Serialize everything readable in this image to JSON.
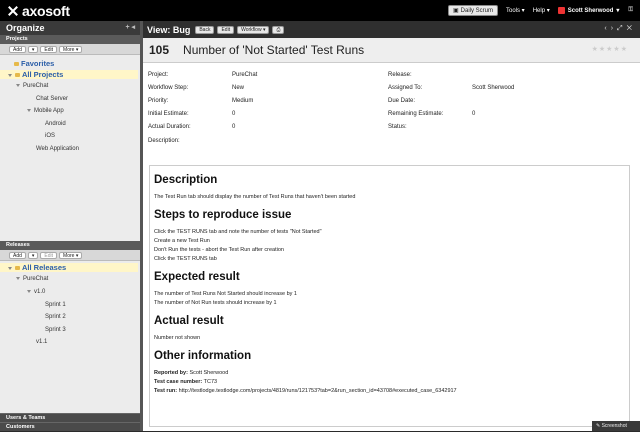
{
  "app": {
    "logo": "axosoft"
  },
  "topbar": {
    "daily_scrum": "Daily Scrum",
    "tools": "Tools",
    "help": "Help",
    "user": "Scott Sherwood"
  },
  "left": {
    "organize": "Organize",
    "projects_header": "Projects",
    "projects_toolbar": {
      "add": "Add",
      "edit": "Edit",
      "more": "More"
    },
    "favorites": "Favorites",
    "all_projects": "All Projects",
    "tree": [
      {
        "label": "PureChat"
      },
      {
        "label": "Chat Server"
      },
      {
        "label": "Mobile App"
      },
      {
        "label": "Android"
      },
      {
        "label": "iOS"
      },
      {
        "label": "Web Application"
      }
    ],
    "releases_header": "Releases",
    "releases_toolbar": {
      "add": "Add",
      "edit": "Edit",
      "more": "More"
    },
    "all_releases": "All Releases",
    "release_tree": [
      {
        "label": "PureChat"
      },
      {
        "label": "v1.0"
      },
      {
        "label": "Sprint 1"
      },
      {
        "label": "Sprint 2"
      },
      {
        "label": "Sprint 3"
      },
      {
        "label": "v1.1"
      }
    ],
    "bottom": {
      "users_teams": "Users & Teams",
      "customers": "Customers"
    }
  },
  "main": {
    "view_title": "View: Bug",
    "buttons": {
      "back": "Back",
      "edit": "Edit",
      "workflow": "Workflow"
    },
    "item_id": "105",
    "item_name": "Number of 'Not Started' Test Runs",
    "fields": {
      "project_label": "Project:",
      "project": "PureChat",
      "release_label": "Release:",
      "release": "",
      "workflow_label": "Workflow Step:",
      "workflow": "New",
      "assigned_label": "Assigned To:",
      "assigned": "Scott Sherwood",
      "priority_label": "Priority:",
      "priority": "Medium",
      "due_label": "Due Date:",
      "due": "",
      "initial_label": "Initial Estimate:",
      "initial": "0",
      "remaining_label": "Remaining Estimate:",
      "remaining": "0",
      "actual_label": "Actual Duration:",
      "actual": "0",
      "status_label": "Status:",
      "status": "",
      "description_label": "Description:"
    },
    "description": {
      "h1": "Description",
      "p1": "The Test Run tab should display the number of Test Runs that haven't been started",
      "h2": "Steps to reproduce issue",
      "steps": [
        "Click the TEST RUNS tab and note the number of tests \"Not Started\"",
        "Create a new Test Run",
        "Don't Run the tests - abort the Test Run after creation",
        "Click the TEST RUNS tab"
      ],
      "h3": "Expected result",
      "expected": [
        "The number of Test Runs Not Started should increase by 1",
        "The number of Not Run tests should increase by 1"
      ],
      "h4": "Actual result",
      "actual": "Number not shown",
      "h5": "Other information",
      "reported_by_label": "Reported by:",
      "reported_by": "Scott Sherwood",
      "case_label": "Test case number:",
      "case": "TC73",
      "run_label": "Test run:",
      "run": "http://testlodge.testlodge.com/projects/4819/runs/121753?tab=2&run_section_id=43708#executed_case_6342917"
    }
  },
  "statusbar": {
    "screenshot": "Screenshot"
  }
}
